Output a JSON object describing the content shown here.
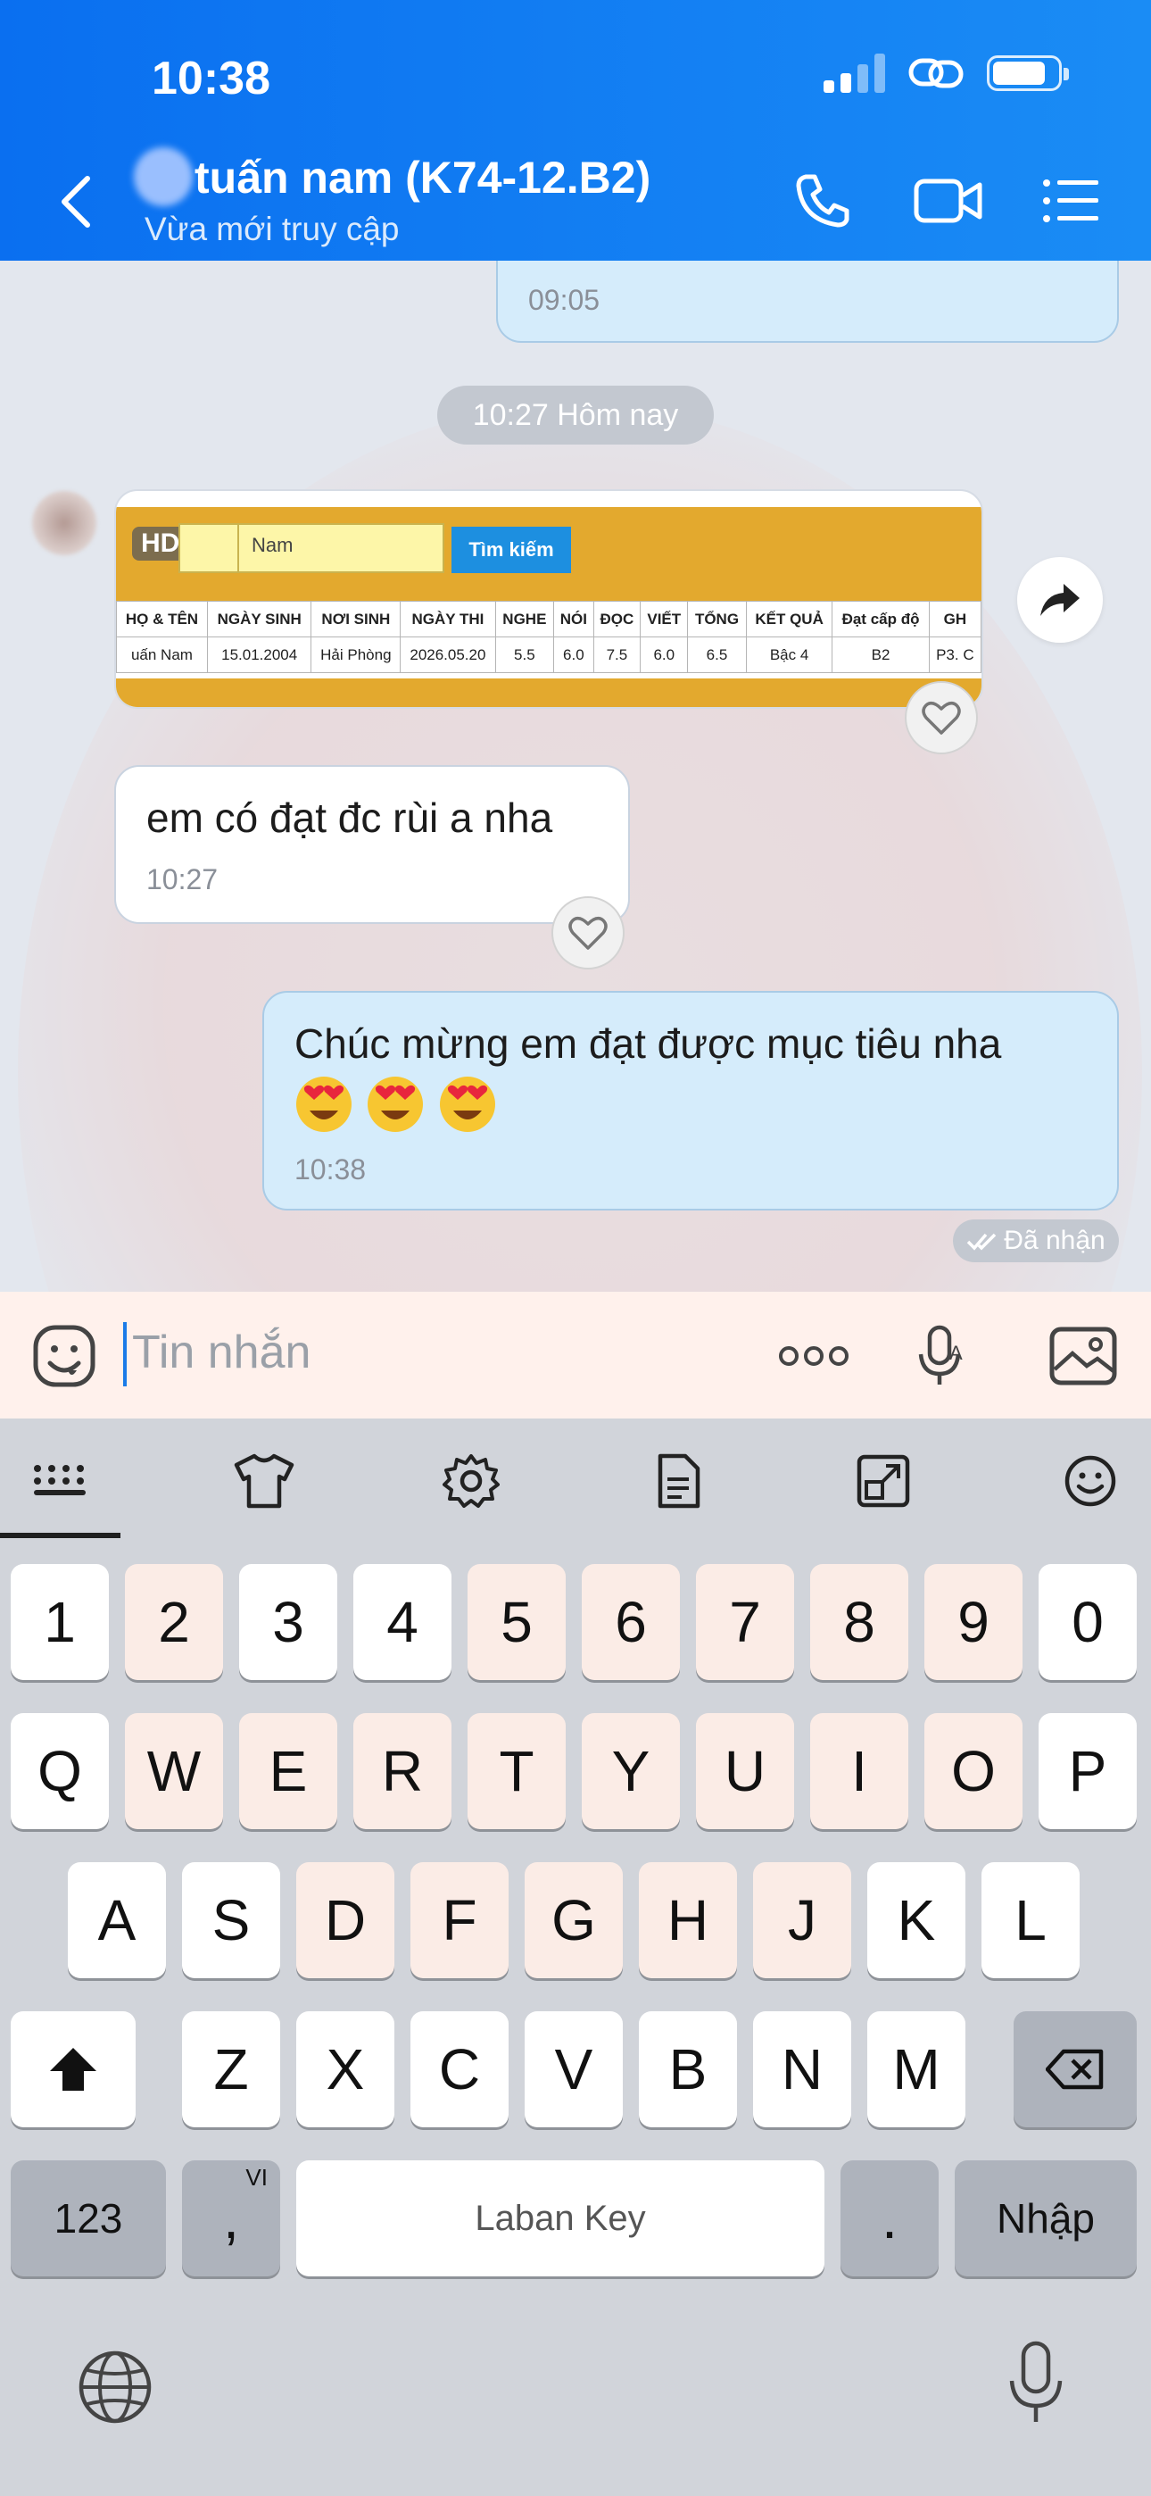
{
  "status_bar": {
    "time": "10:38"
  },
  "header": {
    "title": "tuấn nam (K74-12.B2)",
    "subtitle": "Vừa mới truy cập"
  },
  "messages": {
    "prev_time": "09:05",
    "date_separator": "10:27 Hôm nay",
    "image_card": {
      "badge": "HD",
      "search_placeholder": "Nam",
      "search_button": "Tìm kiếm",
      "headers": [
        "HỌ & TÊN",
        "NGÀY SINH",
        "NƠI SINH",
        "NGÀY THI",
        "NGHE",
        "NÓI",
        "ĐỌC",
        "VIẾT",
        "TỔNG",
        "KẾT QUẢ",
        "Đạt cấp độ",
        "GH"
      ],
      "row": [
        "uấn Nam",
        "15.01.2004",
        "Hải Phòng",
        "2026.05.20",
        "5.5",
        "6.0",
        "7.5",
        "6.0",
        "6.5",
        "Bậc 4",
        "B2",
        "P3. C"
      ]
    },
    "incoming_text": "em có đạt đc rùi a nha",
    "incoming_time": "10:27",
    "outgoing_text": "Chúc mừng em đạt được mục tiêu nha",
    "outgoing_time": "10:38",
    "seen_label": "Đã nhận"
  },
  "input": {
    "placeholder": "Tin nhắn"
  },
  "keyboard": {
    "numbers": [
      "1",
      "2",
      "3",
      "4",
      "5",
      "6",
      "7",
      "8",
      "9",
      "0"
    ],
    "row1": [
      "Q",
      "W",
      "E",
      "R",
      "T",
      "Y",
      "U",
      "I",
      "O",
      "P"
    ],
    "row2": [
      "A",
      "S",
      "D",
      "F",
      "G",
      "H",
      "J",
      "K",
      "L"
    ],
    "row3": [
      "Z",
      "X",
      "C",
      "V",
      "B",
      "N",
      "M"
    ],
    "num_switch": "123",
    "comma": ",",
    "comma_lang": "VI",
    "space": "Laban Key",
    "period": ".",
    "enter": "Nhập"
  },
  "colors": {
    "header": "#0a6ff0",
    "outgoing": "#d5ecfb",
    "accent": "#1a7be8"
  }
}
